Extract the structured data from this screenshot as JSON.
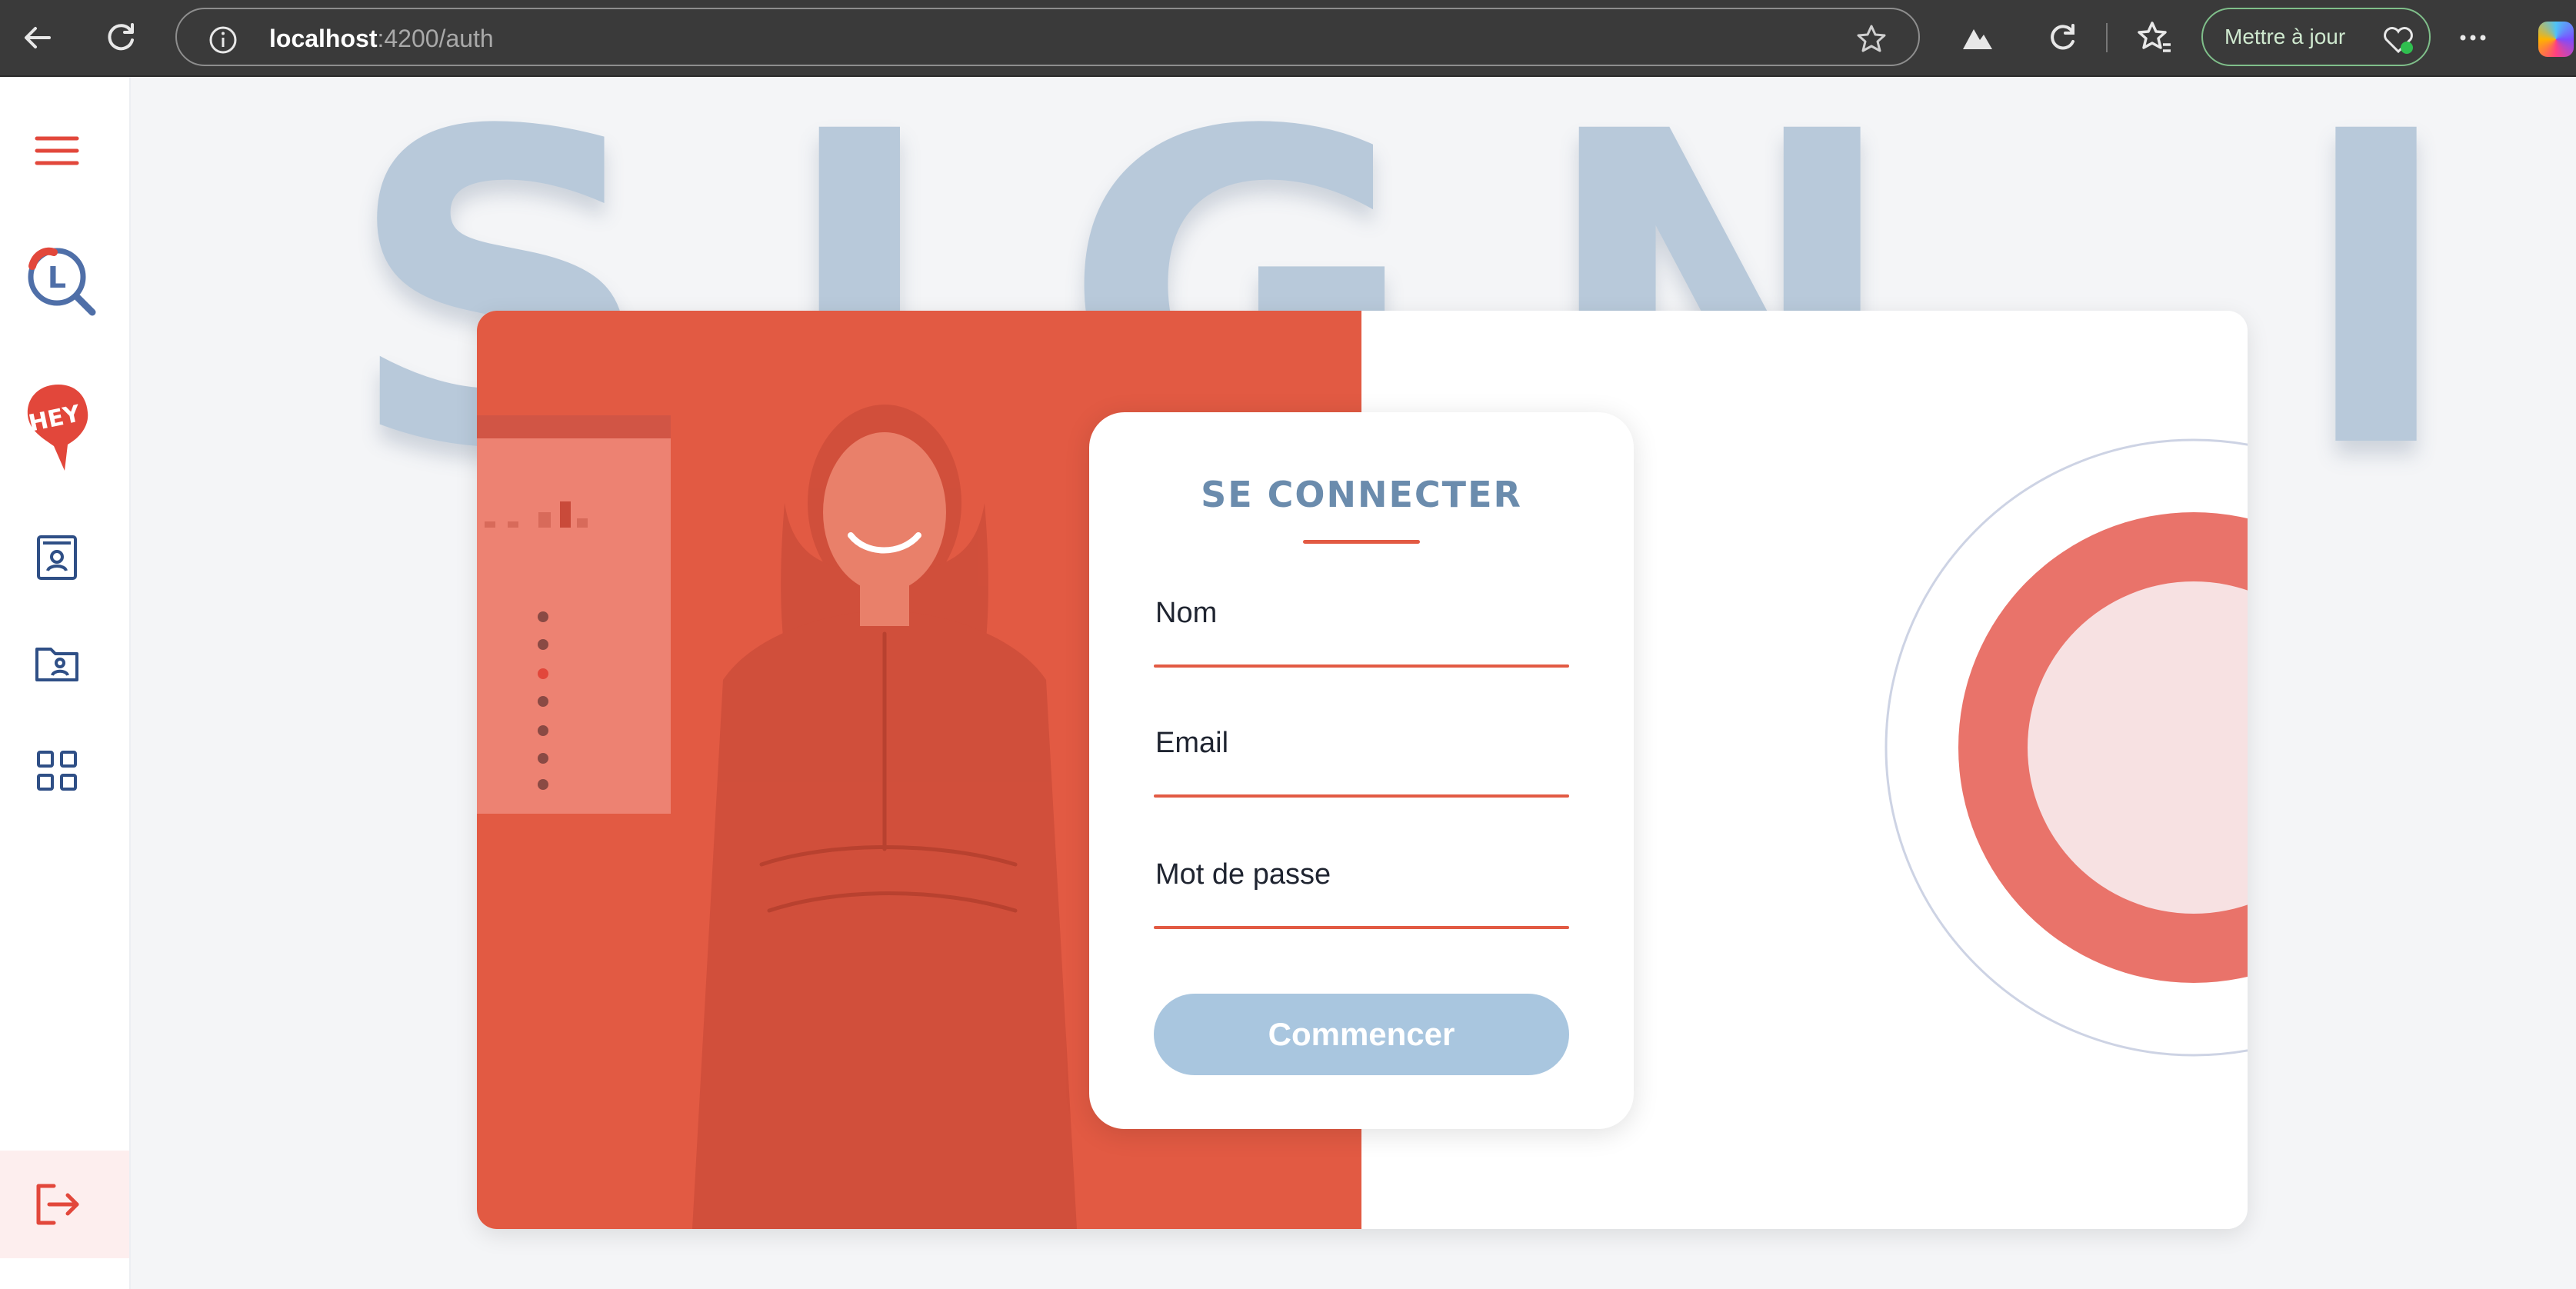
{
  "browser": {
    "url_host": "localhost",
    "url_rest": ":4200/auth",
    "update_label": "Mettre à jour"
  },
  "sidebar": {
    "items": [
      {
        "name": "menu",
        "icon": "hamburger-menu-icon"
      },
      {
        "name": "logo-search",
        "icon": "search-logo-icon"
      },
      {
        "name": "logo-hey",
        "icon": "hey-logo-icon"
      },
      {
        "name": "contacts",
        "icon": "contact-card-icon"
      },
      {
        "name": "folder",
        "icon": "user-folder-icon"
      },
      {
        "name": "dashboard",
        "icon": "grid-apps-icon"
      },
      {
        "name": "logout",
        "icon": "logout-icon"
      }
    ]
  },
  "hero": {
    "background_text": "SIGN IN"
  },
  "form": {
    "title": "SE CONNECTER",
    "fields": [
      {
        "label": "Nom"
      },
      {
        "label": "Email"
      },
      {
        "label": "Mot de passe"
      }
    ],
    "submit_label": "Commencer"
  },
  "colors": {
    "accent": "#e25a43",
    "title_blue": "#6b8cad",
    "button_blue": "#a9c6df",
    "background_text": "#b8c9da"
  }
}
